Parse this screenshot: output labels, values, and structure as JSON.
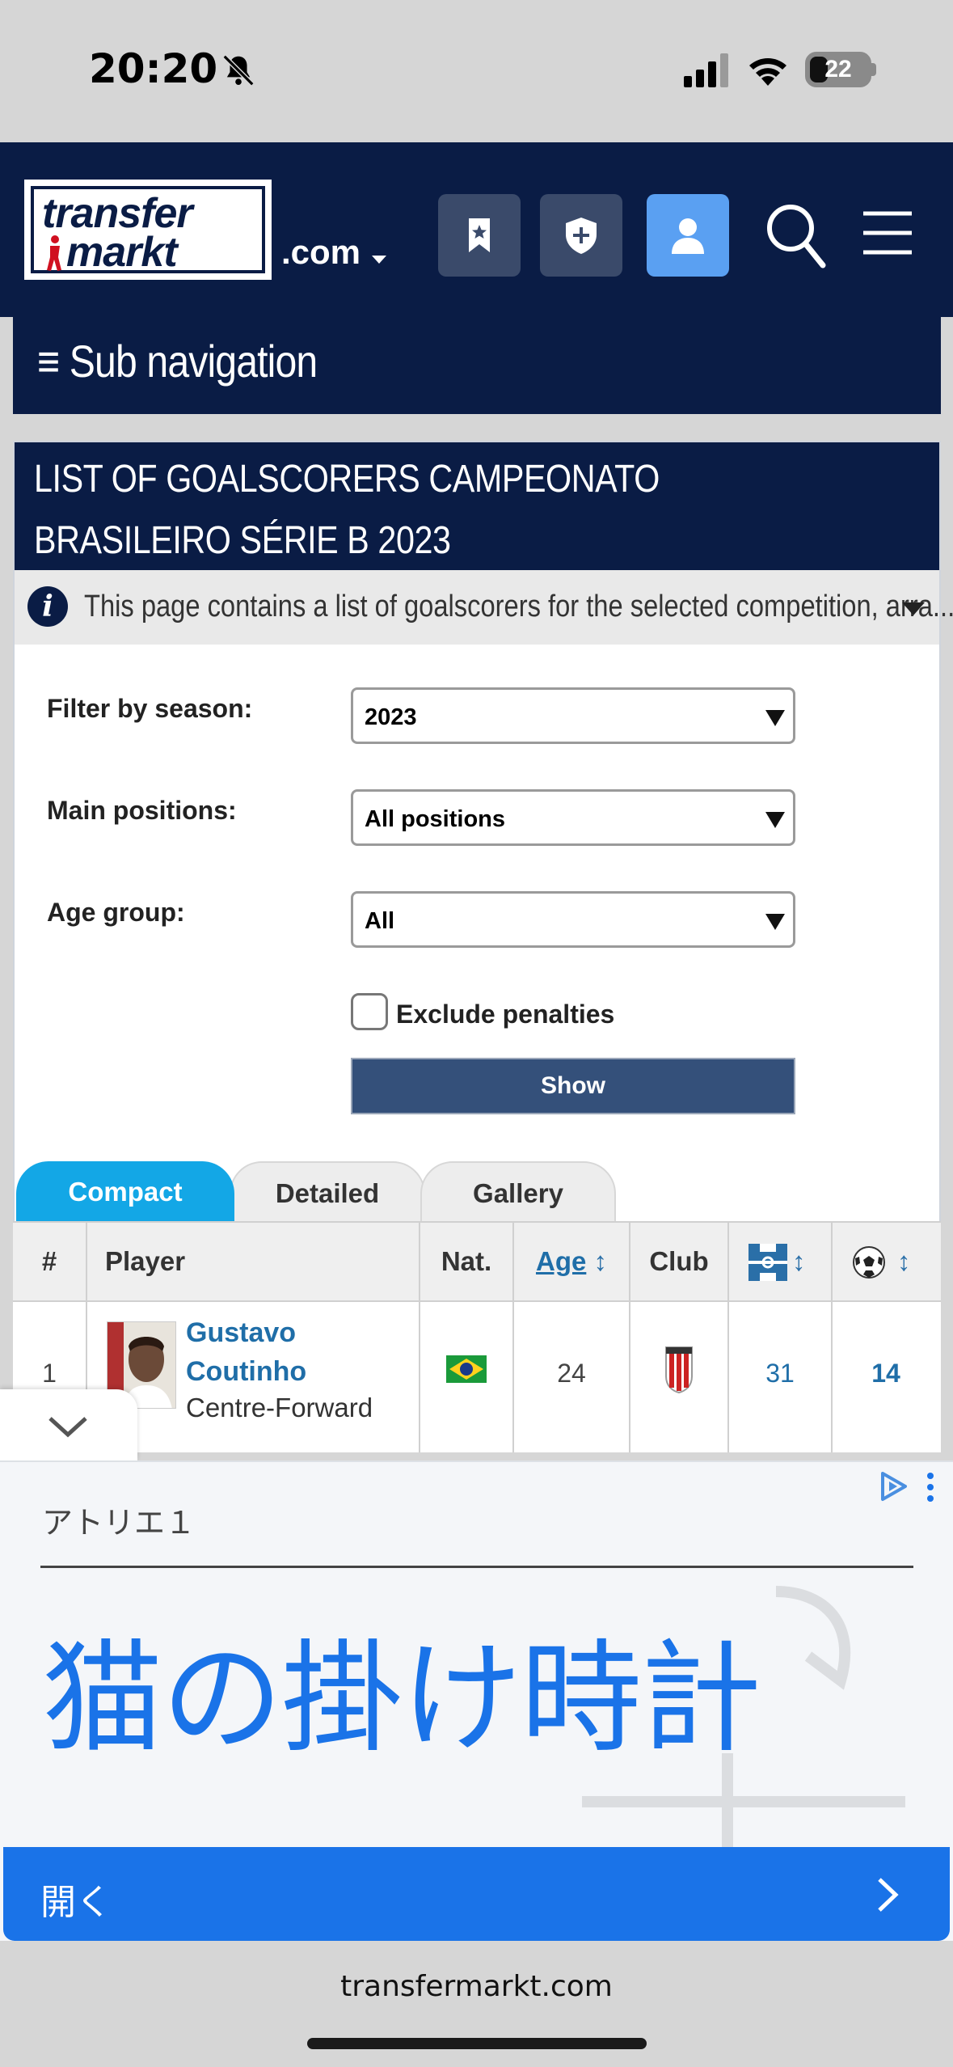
{
  "status_bar": {
    "time": "20:20",
    "battery": "22"
  },
  "header": {
    "logo_line1": "transfer",
    "logo_line2": "markt",
    "domain": ".com"
  },
  "subnav": {
    "label": "≡ Sub navigation"
  },
  "page": {
    "title": "LIST OF GOALSCORERS CAMPEONATO BRASILEIRO SÉRIE B 2023",
    "info": "This page contains a list of goalscorers for the selected competition, arra..."
  },
  "filters": {
    "season_label": "Filter by season:",
    "season_value": "2023",
    "positions_label": "Main positions:",
    "positions_value": "All positions",
    "age_label": "Age group:",
    "age_value": "All",
    "exclude_penalties_label": "Exclude penalties",
    "show_label": "Show"
  },
  "tabs": [
    "Compact",
    "Detailed",
    "Gallery"
  ],
  "table": {
    "headers": {
      "num": "#",
      "player": "Player",
      "nat": "Nat.",
      "age": "Age",
      "club": "Club"
    },
    "rows": [
      {
        "rank": "1",
        "name": "Gustavo Coutinho",
        "position": "Centre-Forward",
        "age": "24",
        "apps": "31",
        "goals": "14"
      }
    ]
  },
  "ad": {
    "advertiser": "アトリエ１",
    "headline": "猫の掛け時計",
    "cta": "開く"
  },
  "footer": {
    "url": "transfermarkt.com"
  },
  "colors": {
    "navy": "#0a1c45",
    "tab_active": "#13a7e6",
    "link": "#1f6ea8",
    "ad_blue": "#1a73e8",
    "show_btn": "#34507a"
  }
}
